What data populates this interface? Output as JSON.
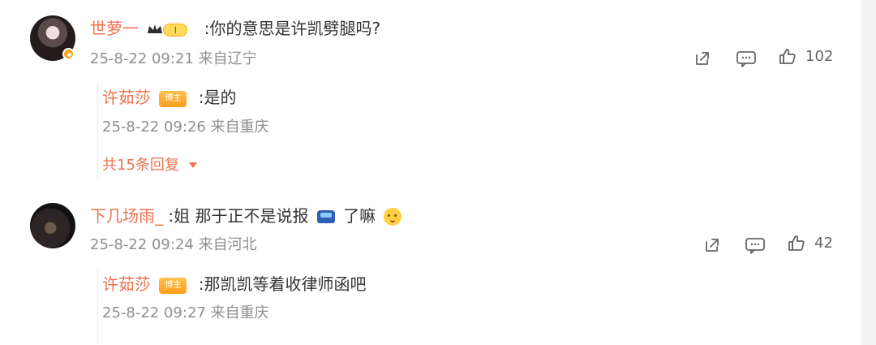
{
  "comments": [
    {
      "user": "世萝一",
      "badge_text": "I",
      "text": ":你的意思是许凯劈腿吗?",
      "meta": "25-8-22 09:21 来自辽宁",
      "likes": "102",
      "reply": {
        "user": "许茹莎",
        "tag": "博主",
        "text": ":是的",
        "meta": "25-8-22 09:26 来自重庆"
      },
      "more_replies": "共15条回复"
    },
    {
      "user": "下几场雨_",
      "text_part1": ":姐 那于正不是说报",
      "text_part2": "了嘛",
      "meta": "25-8-22 09:24 来自河北",
      "likes": "42",
      "reply": {
        "user": "许茹莎",
        "tag": "博主",
        "text": ":那凯凯等着收律师函吧",
        "meta": "25-8-22 09:27 来自重庆"
      }
    }
  ],
  "icons": {
    "share": "share-icon",
    "comment": "comment-icon",
    "like": "like-icon",
    "expand": "chevron-down-icon",
    "verified": "verified-badge-icon"
  },
  "colors": {
    "name": "#eb7350",
    "meta": "#8f8f8f",
    "text": "#333333",
    "accent": "#ff9f1a"
  }
}
